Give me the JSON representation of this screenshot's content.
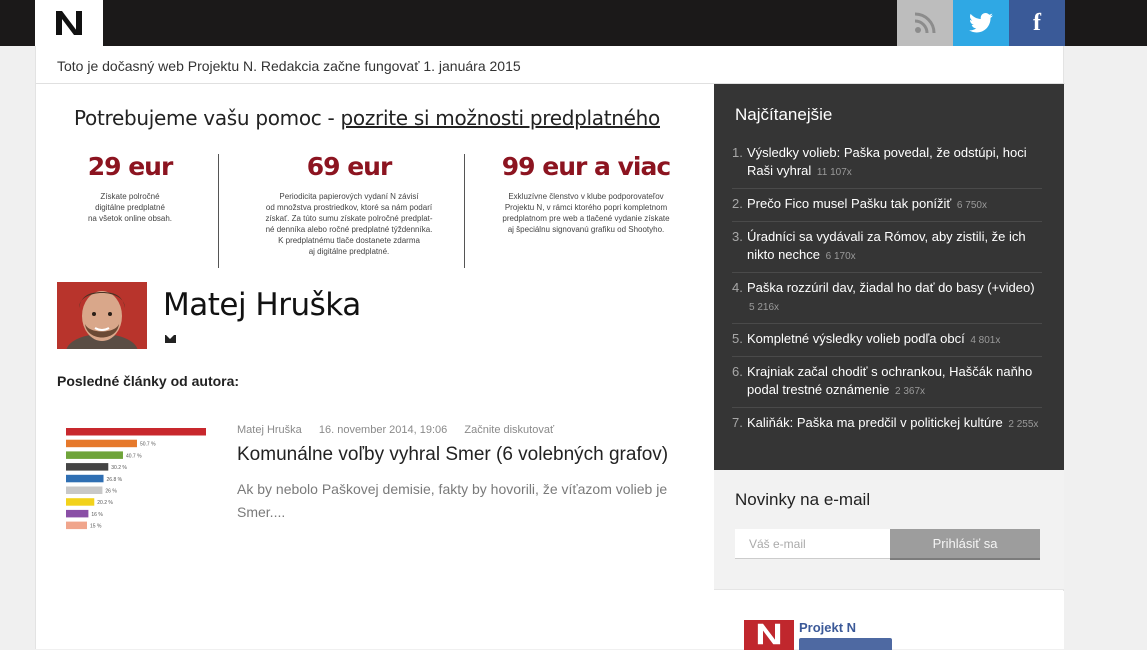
{
  "header": {
    "logo_icon": "projekt-n-logo-icon",
    "social": [
      {
        "name": "rss",
        "icon": "rss-icon",
        "color": "#bdbdbd"
      },
      {
        "name": "twitter",
        "icon": "twitter-bird-icon",
        "color": "#2fa8e4"
      },
      {
        "name": "facebook",
        "icon": "facebook-f-icon",
        "label": "f",
        "color": "#3a5a98"
      }
    ]
  },
  "notice": "Toto je dočasný web Projektu N. Redakcia začne fungovať 1. januára 2015",
  "donation": {
    "lead": "Potrebujeme vašu pomoc - ",
    "link": "pozrite si možnosti predplatného",
    "tiers": [
      {
        "price": "29 eur",
        "lines": [
          "Získate polročné",
          "digitálne predplatné",
          "na všetok online obsah."
        ]
      },
      {
        "price": "69 eur",
        "lines": [
          "Periodicita papierových vydaní N závisí",
          "od množstva prostriedkov, ktoré sa nám podarí",
          "získať. Za túto sumu získate polročné predplat-",
          "né denníka alebo ročné predplatné týždenníka.",
          "K predplatnému tlače dostanete zdarma",
          "aj digitálne predplatné."
        ]
      },
      {
        "price": "99 eur a viac",
        "lines": [
          "Exkluzívne členstvo v klube podporovateľov",
          "Projektu N, v rámci ktorého popri kompletnom",
          "predplatnom pre web a tlačené vydanie získate",
          "aj špeciálnu signovanú grafiku od Shootyho."
        ]
      }
    ]
  },
  "author": {
    "name": "Matej Hruška",
    "mail_icon": "envelope-icon"
  },
  "latest_label": "Posledné články od autora:",
  "article": {
    "author": "Matej Hruška",
    "date": "16. november 2014, 19:06",
    "discuss": "Začnite diskutovať",
    "title": "Komunálne voľby vyhral Smer (6 volebných grafov)",
    "excerpt": "Ak by nebolo Paškovej demisie, fakty by hovorili, že víťazom volieb je Smer....",
    "thumb_bars": [
      {
        "value": 100,
        "label": "",
        "color": "#c8282d"
      },
      {
        "value": 50.7,
        "label": "50.7 %",
        "color": "#e6792b"
      },
      {
        "value": 40.7,
        "label": "40.7 %",
        "color": "#6fa43a"
      },
      {
        "value": 30.2,
        "label": "30.2 %",
        "color": "#444444"
      },
      {
        "value": 26.8,
        "label": "26.8 %",
        "color": "#2f6fb3"
      },
      {
        "value": 26,
        "label": "26 %",
        "color": "#c8c8c8"
      },
      {
        "value": 20.2,
        "label": "20.2 %",
        "color": "#f2d21b"
      },
      {
        "value": 16,
        "label": "16 %",
        "color": "#8a4fa6"
      },
      {
        "value": 15,
        "label": "15 %",
        "color": "#f0a58c"
      }
    ]
  },
  "most_read": {
    "title": "Najčítanejšie",
    "items": [
      {
        "num": "1.",
        "text": "Výsledky volieb: Paška povedal, že odstúpi, hoci Raši vyhral",
        "count": "11 107x"
      },
      {
        "num": "2.",
        "text": "Prečo Fico musel Pašku tak ponížiť",
        "count": "6 750x"
      },
      {
        "num": "3.",
        "text": "Úradníci sa vydávali za Rómov, aby zistili, že ich nikto nechce",
        "count": "6 170x"
      },
      {
        "num": "4.",
        "text": "Paška rozzúril dav, žiadal ho dať do basy (+video)",
        "count": "5 216x"
      },
      {
        "num": "5.",
        "text": "Kompletné výsledky volieb podľa obcí",
        "count": "4 801x"
      },
      {
        "num": "6.",
        "text": "Krajniak začal chodiť s ochrankou, Haščák naňho podal trestné oznámenie",
        "count": "2 367x"
      },
      {
        "num": "7.",
        "text": "Kaliňák: Paška ma predčil v politickej kultúre",
        "count": "2 255x"
      }
    ]
  },
  "newsletter": {
    "title": "Novinky na e-mail",
    "placeholder": "Váš e-mail",
    "button": "Prihlásiť sa"
  },
  "facebook_box": {
    "page_name": "Projekt N"
  }
}
